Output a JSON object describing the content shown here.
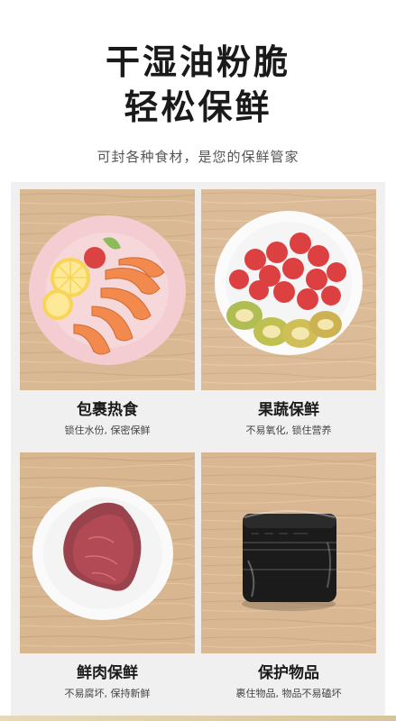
{
  "header": {
    "title_line1": "干湿油粉脆",
    "title_line2": "轻松保鲜",
    "subtitle": "可封各种食材，是您的保鲜管家"
  },
  "cards": [
    {
      "label": "包裹热食",
      "desc": "锁住水份, 保密保鲜"
    },
    {
      "label": "果蔬保鲜",
      "desc": "不易氧化, 锁住营养"
    },
    {
      "label": "鲜肉保鲜",
      "desc": "不易腐坏, 保持新鲜"
    },
    {
      "label": "保护物品",
      "desc": "裹住物品, 物品不易磕坏"
    }
  ],
  "colors": {
    "wood": "#d8b994",
    "plate_pink": "#f1c8cc",
    "plate_white": "#fbfbfb"
  }
}
